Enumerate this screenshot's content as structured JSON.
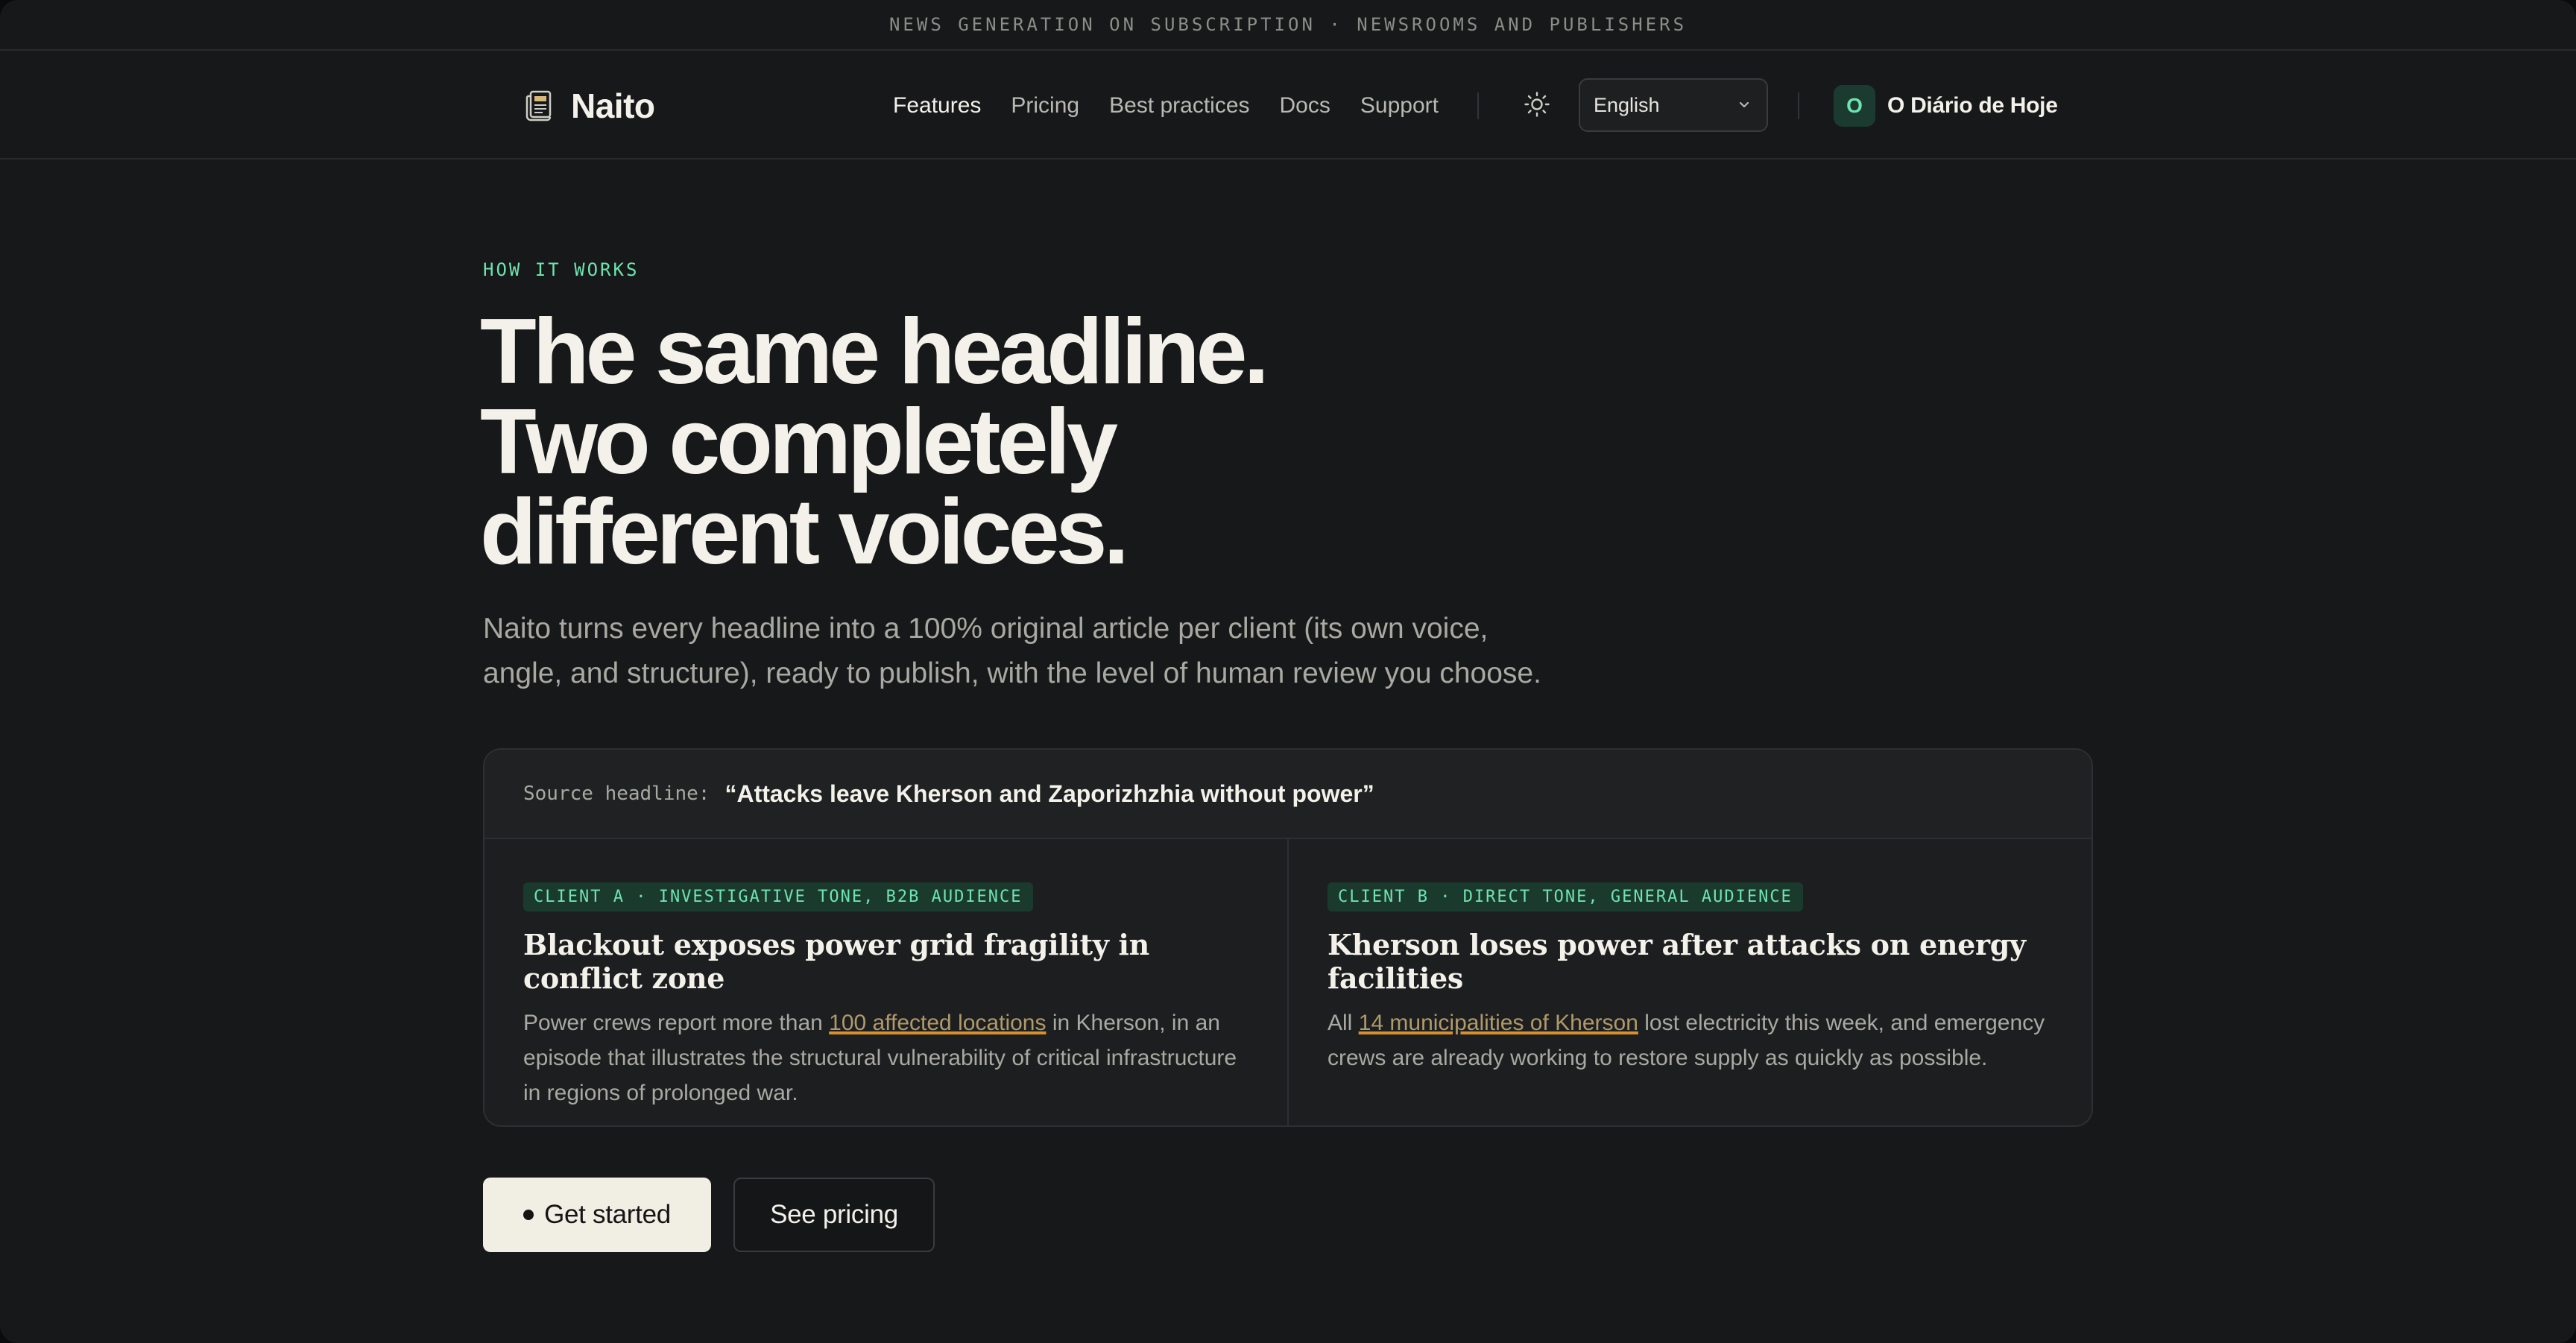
{
  "announcement": "NEWS GENERATION ON SUBSCRIPTION · NEWSROOMS AND PUBLISHERS",
  "brand": {
    "name": "Naito",
    "icon": "newspaper-icon"
  },
  "nav": {
    "items": [
      {
        "label": "Features",
        "active": true
      },
      {
        "label": "Pricing",
        "active": false
      },
      {
        "label": "Best practices",
        "active": false
      },
      {
        "label": "Docs",
        "active": false
      },
      {
        "label": "Support",
        "active": false
      }
    ],
    "theme_icon": "sun-icon",
    "language": {
      "selected": "English"
    },
    "account": {
      "initial": "O",
      "name": "O Diário de Hoje"
    }
  },
  "hero": {
    "eyebrow": "HOW IT WORKS",
    "headline": [
      "The same headline.",
      "Two completely",
      "different voices."
    ],
    "lede": "Naito turns every headline into a 100% original article per client (its own voice, angle, and structure), ready to publish, with the level of human review you choose."
  },
  "example": {
    "source_label": "Source headline:",
    "source_text": "“Attacks leave Kherson and Zaporizhzhia without power”",
    "clients": [
      {
        "tag": "CLIENT A · INVESTIGATIVE TONE, B2B AUDIENCE",
        "title": "Blackout exposes power grid fragility in conflict zone",
        "body_before": "Power crews report more than ",
        "body_highlight": "100 affected locations",
        "body_after": " in Kherson, in an episode that illustrates the structural vulnerability of critical infrastructure in regions of prolonged war."
      },
      {
        "tag": "CLIENT B · DIRECT TONE, GENERAL AUDIENCE",
        "title": "Kherson loses power after attacks on energy facilities",
        "body_before": "All ",
        "body_highlight": "14 municipalities of Kherson",
        "body_after": " lost electricity this week, and emergency crews are already working to restore supply as quickly as possible."
      }
    ]
  },
  "cta": {
    "primary": "Get started",
    "secondary": "See pricing"
  },
  "colors": {
    "accent": "#6fe3b0",
    "highlight_underline": "#d98f2a",
    "background": "#171819"
  }
}
